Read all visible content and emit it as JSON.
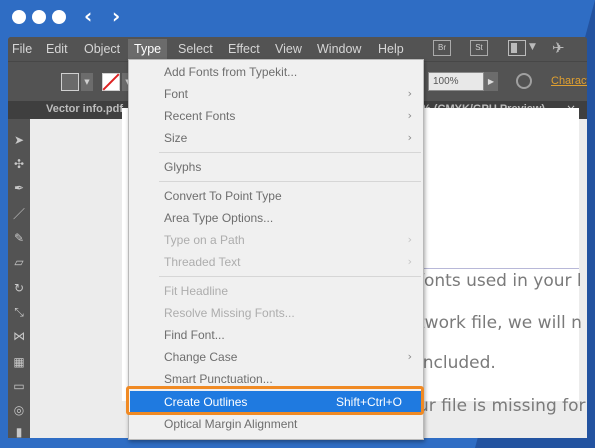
{
  "window": {
    "nav_back": "‹",
    "nav_forward": "›"
  },
  "menubar": {
    "items": [
      "File",
      "Edit",
      "Object",
      "Type",
      "Select",
      "Effect",
      "View",
      "Window",
      "Help"
    ],
    "active": "Type",
    "bridge_label": "Br",
    "stock_label": "St"
  },
  "controlbar": {
    "opacity_value": "100%",
    "character_link": "Characte"
  },
  "tabs": {
    "left_title": "Vector info.pdf",
    "right_title": "% (CMYK/GPU Preview)",
    "close": "×"
  },
  "document_text": [
    "fonts used in your l",
    "twork file, we will n",
    "included.",
    "ur file is missing for"
  ],
  "type_menu": {
    "items": [
      {
        "label": "Add Fonts from Typekit...",
        "disabled": false,
        "submenu": false
      },
      {
        "label": "Font",
        "disabled": false,
        "submenu": true
      },
      {
        "label": "Recent Fonts",
        "disabled": false,
        "submenu": true
      },
      {
        "label": "Size",
        "disabled": false,
        "submenu": true
      },
      {
        "label": "Glyphs",
        "disabled": false,
        "submenu": false
      },
      {
        "label": "Convert To Point Type",
        "disabled": false,
        "submenu": false
      },
      {
        "label": "Area Type Options...",
        "disabled": false,
        "submenu": false
      },
      {
        "label": "Type on a Path",
        "disabled": true,
        "submenu": true
      },
      {
        "label": "Threaded Text",
        "disabled": true,
        "submenu": true
      },
      {
        "label": "Fit Headline",
        "disabled": true,
        "submenu": false
      },
      {
        "label": "Resolve Missing Fonts...",
        "disabled": true,
        "submenu": false
      },
      {
        "label": "Find Font...",
        "disabled": false,
        "submenu": false
      },
      {
        "label": "Change Case",
        "disabled": false,
        "submenu": true
      },
      {
        "label": "Smart Punctuation...",
        "disabled": false,
        "submenu": false
      },
      {
        "label": "Create Outlines",
        "disabled": false,
        "submenu": false,
        "selected": true,
        "shortcut": "Shift+Ctrl+O"
      },
      {
        "label": "Optical Margin Alignment",
        "disabled": false,
        "submenu": false
      }
    ],
    "submenu_arrow": "›"
  },
  "colors": {
    "frame_blue": "#2f6dc4",
    "menu_selected": "#1f7ae0",
    "highlight_orange": "#f08a24"
  }
}
